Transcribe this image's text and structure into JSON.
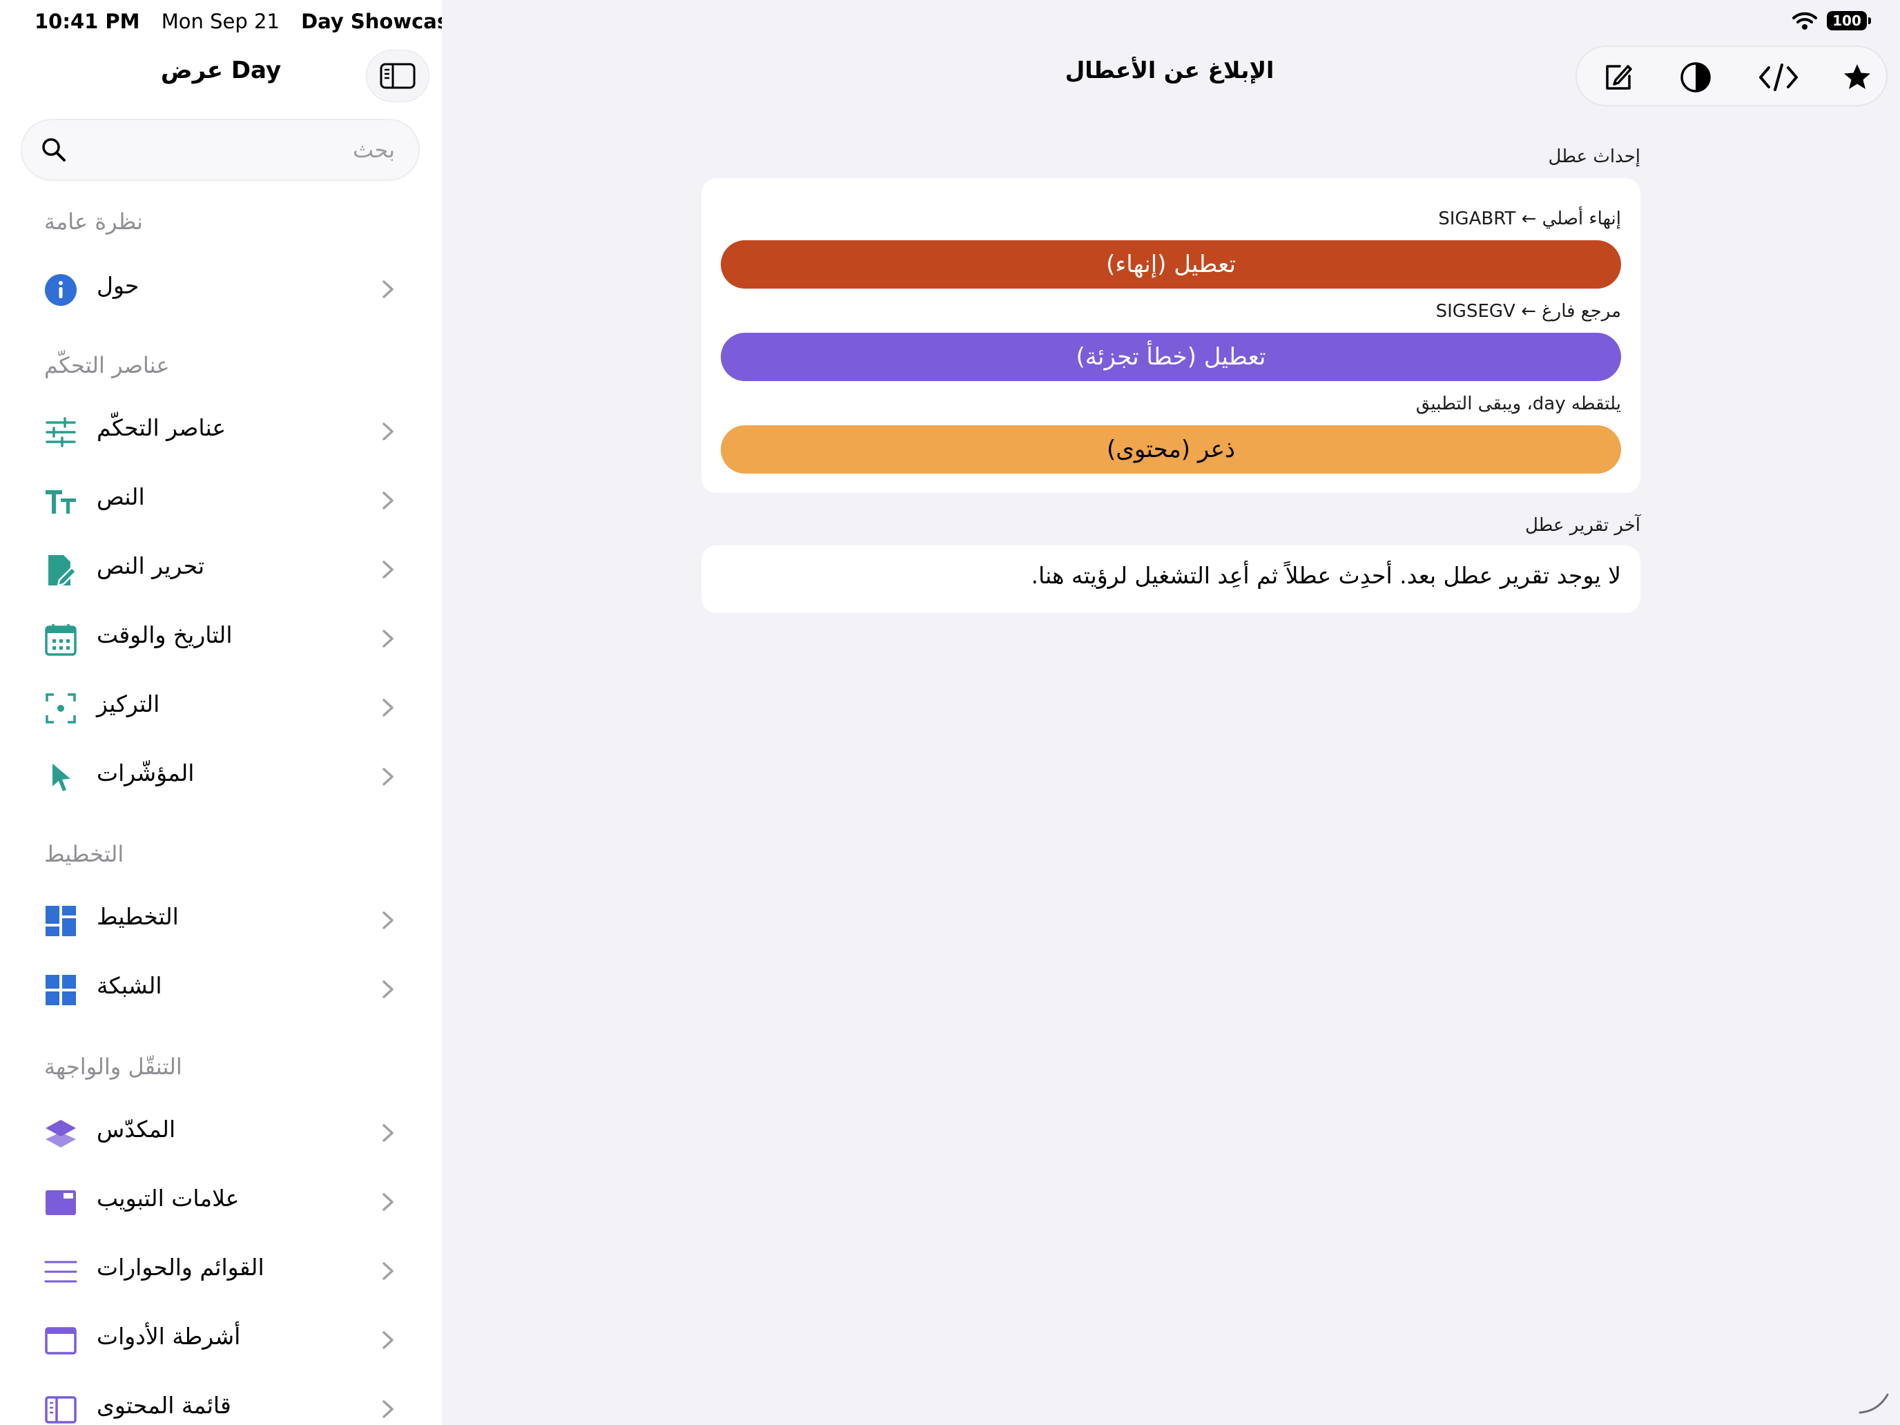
{
  "status_bar": {
    "time": "10:41 PM",
    "date": "Mon Sep 21",
    "app_name": "Day Showcase",
    "battery": "100"
  },
  "sidebar": {
    "title": "عرض Day",
    "search": {
      "placeholder": "بحث",
      "value": ""
    },
    "sections": [
      {
        "header": "نظرة عامة",
        "items": [
          {
            "label": "حول",
            "icon": "info-icon"
          }
        ]
      },
      {
        "header": "عناصر التحكّم",
        "items": [
          {
            "label": "عناصر التحكّم",
            "icon": "sliders-icon"
          },
          {
            "label": "النص",
            "icon": "text-size-icon"
          },
          {
            "label": "تحرير النص",
            "icon": "document-edit-icon"
          },
          {
            "label": "التاريخ والوقت",
            "icon": "calendar-icon"
          },
          {
            "label": "التركيز",
            "icon": "focus-icon"
          },
          {
            "label": "المؤشّرات",
            "icon": "pointer-icon"
          }
        ]
      },
      {
        "header": "التخطيط",
        "items": [
          {
            "label": "التخطيط",
            "icon": "layout-icon"
          },
          {
            "label": "الشبكة",
            "icon": "grid-icon"
          }
        ]
      },
      {
        "header": "التنقّل والواجهة",
        "items": [
          {
            "label": "المكدّس",
            "icon": "stack-icon"
          },
          {
            "label": "علامات التبويب",
            "icon": "tabs-icon"
          },
          {
            "label": "القوائم والحوارات",
            "icon": "menu-lines-icon"
          },
          {
            "label": "أشرطة الأدوات",
            "icon": "toolbar-window-icon"
          },
          {
            "label": "قائمة المحتوى",
            "icon": "sidebar-panel-icon"
          }
        ]
      }
    ]
  },
  "main": {
    "title": "الإبلاغ عن الأعطال",
    "toolbar_icons": [
      "compose-icon",
      "contrast-icon",
      "code-icon",
      "star-icon"
    ],
    "trigger_group": {
      "label": "إحداث عطل",
      "rows": [
        {
          "caption": "إنهاء أصلي ← SIGABRT",
          "button": "تعطيل (إنهاء)",
          "color": "#c1471e",
          "text_color": "#ffffff"
        },
        {
          "caption": "مرجع فارغ ← SIGSEGV",
          "button": "تعطيل (خطأ تجزئة)",
          "color": "#7b5cd9",
          "text_color": "#ffffff"
        },
        {
          "caption": "يلتقطه day، ويبقى التطبيق",
          "button": "ذعر (محتوى)",
          "color": "#efa64c",
          "text_color": "#000000"
        }
      ]
    },
    "report_group": {
      "label": "آخر تقرير عطل",
      "text": "لا يوجد تقرير عطل بعد. أحدِث عطلاً ثم أعِد التشغيل لرؤيته هنا."
    }
  },
  "colors": {
    "sidebar_bg": "#ffffff",
    "main_bg": "#f2f2f7",
    "accent_teal": "#2a9d8f",
    "accent_blue": "#2f6fd6",
    "accent_purple": "#7b5cd9",
    "secondary_text": "#8e8e93"
  }
}
